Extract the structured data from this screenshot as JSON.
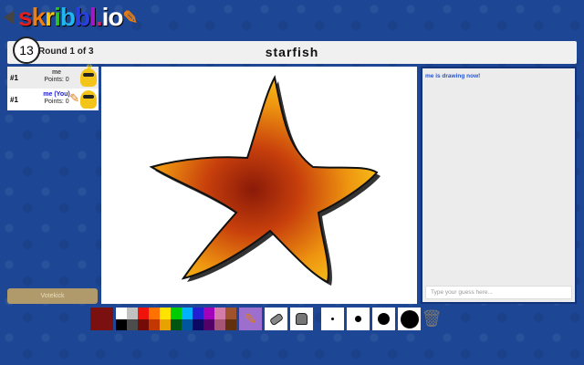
{
  "logo": {
    "text": "skribbl.io",
    "letters": [
      [
        "s",
        "#e02020"
      ],
      [
        "k",
        "#f07d10"
      ],
      [
        "r",
        "#f2c318"
      ],
      [
        "i",
        "#2cc12c"
      ],
      [
        "b",
        "#21b6f0"
      ],
      [
        "b",
        "#2a3fe0"
      ],
      [
        "l",
        "#a418c9"
      ],
      [
        ".",
        "#d41f6a"
      ],
      [
        "i",
        "#ffffff"
      ],
      [
        "o",
        "#ffffff"
      ]
    ]
  },
  "header": {
    "timer": "13",
    "round": "Round 1 of 3",
    "word": "starfish"
  },
  "players": [
    {
      "rank": "#1",
      "name": "me",
      "points": "Points: 0",
      "you": false,
      "owner": true,
      "drawing": false
    },
    {
      "rank": "#1",
      "name": "me (You)",
      "points": "Points: 0",
      "you": true,
      "owner": false,
      "drawing": true
    }
  ],
  "chat": {
    "messages": [
      "me is drawing now!"
    ],
    "placeholder": "Type your guess here..."
  },
  "votekick": "Votekick",
  "toolbar": {
    "current_color": "#7a1010",
    "palette": [
      "#ffffff",
      "#c1c1c1",
      "#ef130b",
      "#ff7100",
      "#ffe400",
      "#00cc00",
      "#00b2ff",
      "#231fd3",
      "#a300ba",
      "#d37caa",
      "#a0522d",
      "#000000",
      "#4c4c4c",
      "#740b07",
      "#c23800",
      "#e8a200",
      "#005510",
      "#00569e",
      "#0e0865",
      "#550069",
      "#a75574",
      "#63300d"
    ],
    "tools": [
      "pencil-icon",
      "eraser-icon",
      "fill-bucket-icon"
    ],
    "selected_tool": "pencil-icon",
    "brush_sizes": [
      3,
      7,
      13,
      20
    ],
    "clear": "trash-icon"
  }
}
